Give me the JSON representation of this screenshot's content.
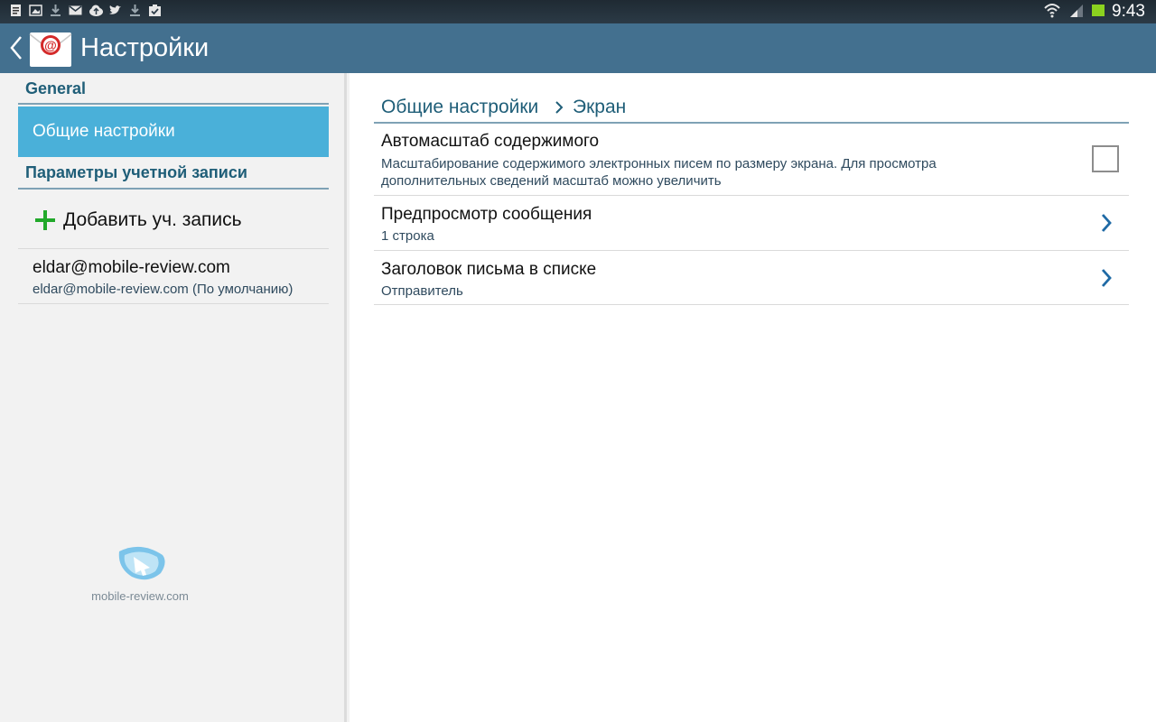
{
  "status_bar": {
    "time": "9:43",
    "icons": [
      "document-icon",
      "image-icon",
      "download-icon",
      "gmail-icon",
      "cloud-upload-icon",
      "twitter-icon",
      "download-icon",
      "clipboard-check-icon",
      "wifi-icon",
      "signal-icon",
      "battery-icon"
    ]
  },
  "action_bar": {
    "title": "Настройки",
    "app_icon": "email-app-icon"
  },
  "sidebar": {
    "section_general": "General",
    "selected_item": "Общие настройки",
    "section_account": "Параметры учетной записи",
    "add_account_label": "Добавить уч. запись",
    "account": {
      "title": "eldar@mobile-review.com",
      "subtitle": "eldar@mobile-review.com (По умолчанию)"
    },
    "watermark_text": "mobile-review.com"
  },
  "main": {
    "breadcrumb": [
      "Общие настройки",
      "Экран"
    ],
    "settings": [
      {
        "title": "Автомасштаб содержимого",
        "subtitle": "Масштабирование содержимого электронных писем по размеру экрана. Для просмотра дополнительных сведений масштаб можно увеличить",
        "control": "checkbox",
        "checked": false
      },
      {
        "title": "Предпросмотр сообщения",
        "subtitle": "1 строка",
        "control": "chevron"
      },
      {
        "title": "Заголовок письма в списке",
        "subtitle": "Отправитель",
        "control": "chevron"
      }
    ]
  },
  "colors": {
    "action_bar": "#43708f",
    "selected": "#4ab0d9",
    "section_text": "#1f5e78",
    "battery": "#8bd21f",
    "plus": "#22a92b"
  }
}
